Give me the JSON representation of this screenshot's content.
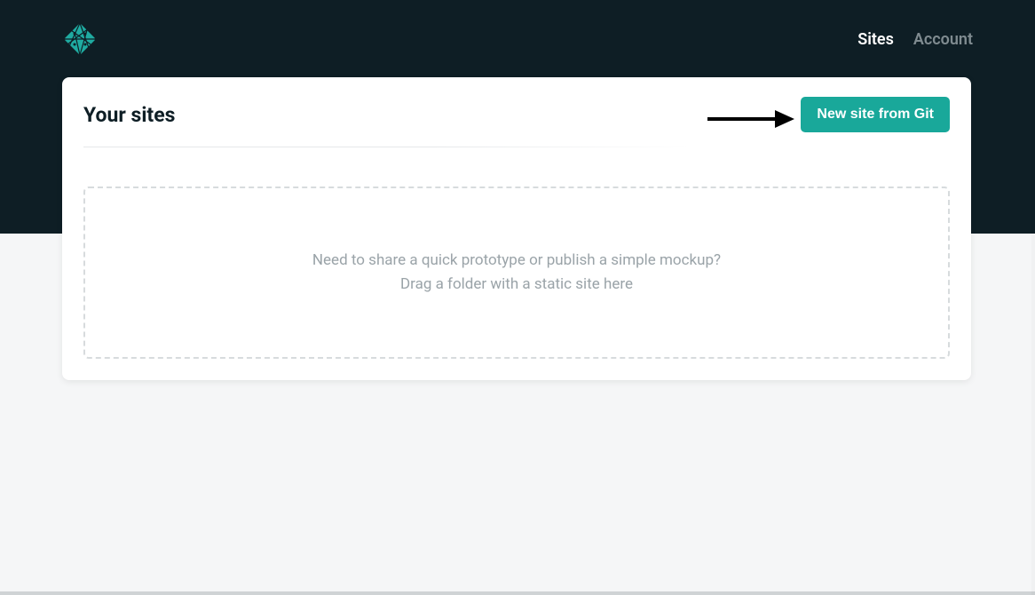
{
  "nav": {
    "sites": "Sites",
    "account": "Account"
  },
  "page": {
    "title": "Your sites"
  },
  "actions": {
    "new_site": "New site from Git"
  },
  "dropzone": {
    "line1": "Need to share a quick prototype or publish a simple mockup?",
    "line2": "Drag a folder with a static site here"
  },
  "colors": {
    "header_bg": "#0e1e25",
    "accent": "#19a89a",
    "muted_text": "#9aa3a8"
  }
}
